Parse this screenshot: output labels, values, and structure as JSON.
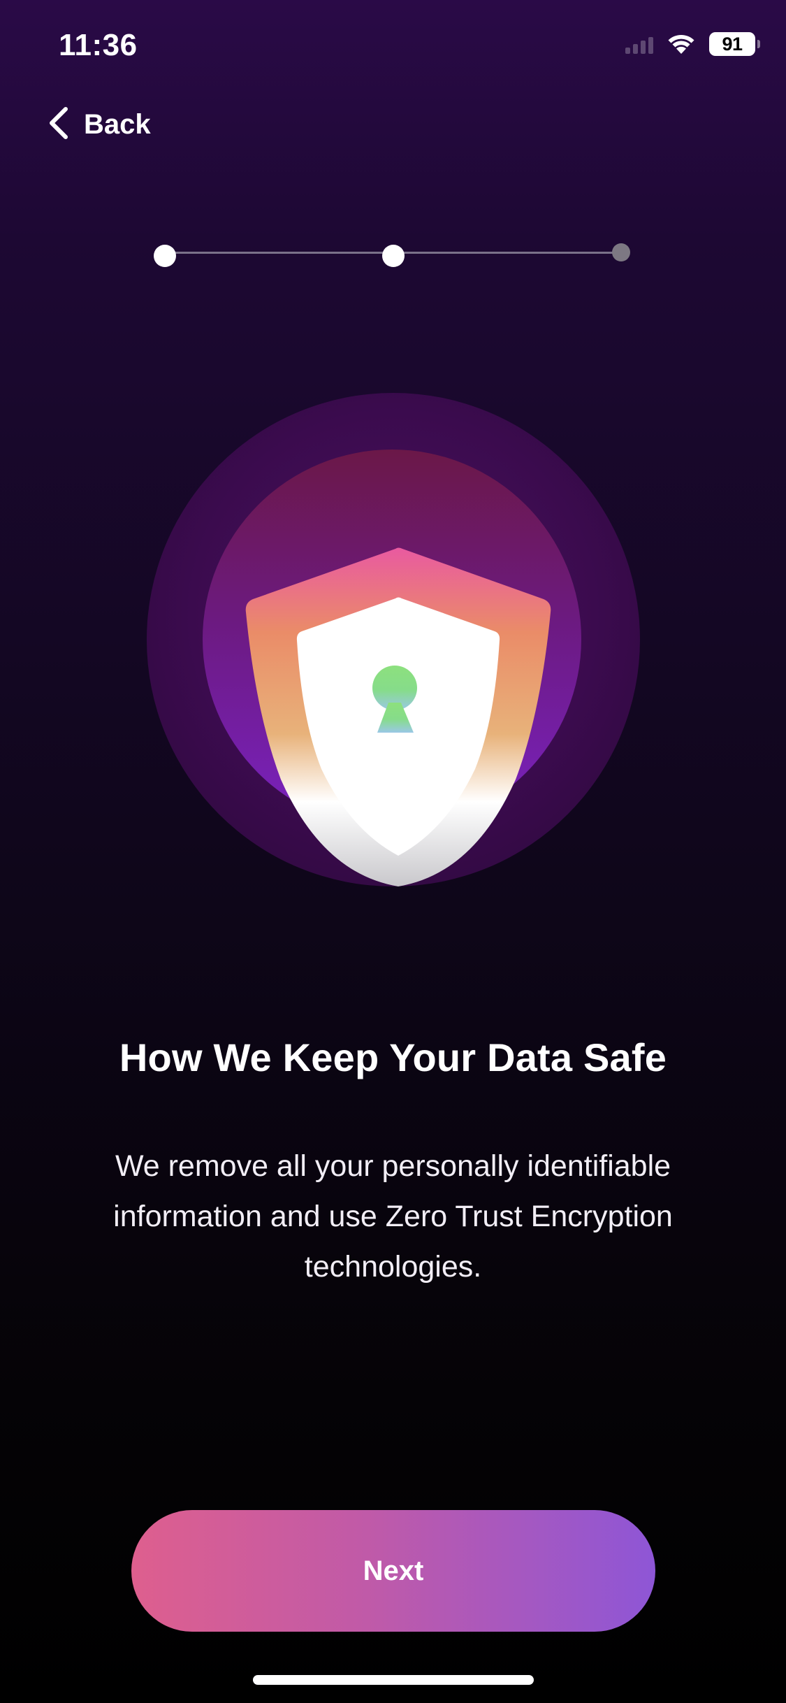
{
  "status_bar": {
    "time": "11:36",
    "battery_level": "91",
    "icons": [
      "signal-icon",
      "wifi-icon",
      "battery-icon"
    ]
  },
  "nav": {
    "back_label": "Back"
  },
  "stepper": {
    "total_steps": 3,
    "current_step": 2
  },
  "content": {
    "title": "How We Keep Your Data Safe",
    "description": "We remove all your personally identifiable information and use Zero Trust Encryption technologies."
  },
  "actions": {
    "next_label": "Next"
  },
  "colors": {
    "background_top": "#2a0a47",
    "background_bottom": "#000000",
    "button_start": "#de5f8e",
    "button_end": "#8e56d6",
    "keyhole_top": "#8de07e",
    "keyhole_bottom": "#9ac8e6"
  }
}
